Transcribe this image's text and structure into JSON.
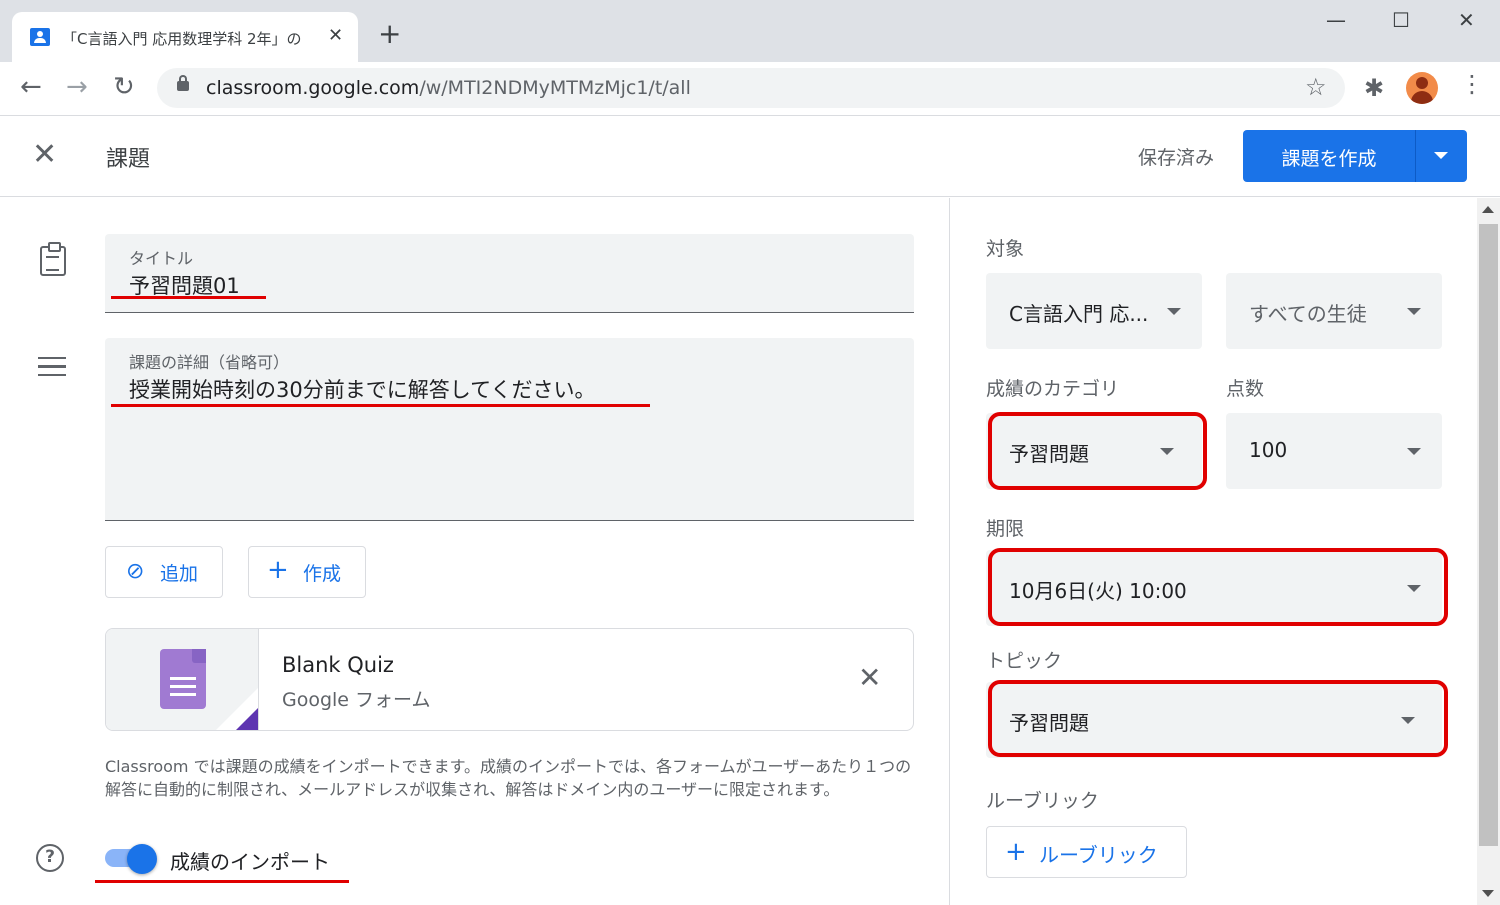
{
  "browser": {
    "tab_title": "「C言語入門 応用数理学科 2年」の",
    "tab_close": "✕",
    "new_tab": "+",
    "url_host": "classroom.google.com",
    "url_path": "/w/MTI2NDMyMTMzMjc1/t/all",
    "icons": [
      "back-arrow-icon",
      "forward-arrow-icon",
      "reload-icon",
      "lock-icon",
      "star-icon",
      "extensions-icon",
      "avatar",
      "more-vert-icon"
    ]
  },
  "header": {
    "title": "課題",
    "saved_status": "保存済み",
    "create_button": "課題を作成"
  },
  "form": {
    "title_label": "タイトル",
    "title_value": "予習問題01",
    "details_label": "課題の詳細（省略可）",
    "details_value": "授業開始時刻の30分前までに解答してください。",
    "add_button": "追加",
    "create_button": "作成"
  },
  "attachment": {
    "title": "Blank Quiz",
    "subtitle": "Google フォーム"
  },
  "import_info": "Classroom では課題の成績をインポートできます。成績のインポートでは、各フォームがユーザーあたり１つの解答に自動的に制限され、メールアドレスが収集され、解答はドメイン内のユーザーに限定されます。",
  "grade_import": {
    "label": "成績のインポート",
    "enabled": true
  },
  "settings": {
    "for_label": "対象",
    "class_value": "C言語入門 応...",
    "students_value": "すべての生徒",
    "category_label": "成績のカテゴリ",
    "category_value": "予習問題",
    "points_label": "点数",
    "points_value": "100",
    "due_label": "期限",
    "due_value": "10月6日(火) 10:00",
    "topic_label": "トピック",
    "topic_value": "予習問題",
    "rubric_label": "ルーブリック",
    "rubric_button": "ルーブリック"
  },
  "colors": {
    "accent": "#1a73e8",
    "annotation_red": "#e00000",
    "field_bg": "#f1f3f4"
  }
}
